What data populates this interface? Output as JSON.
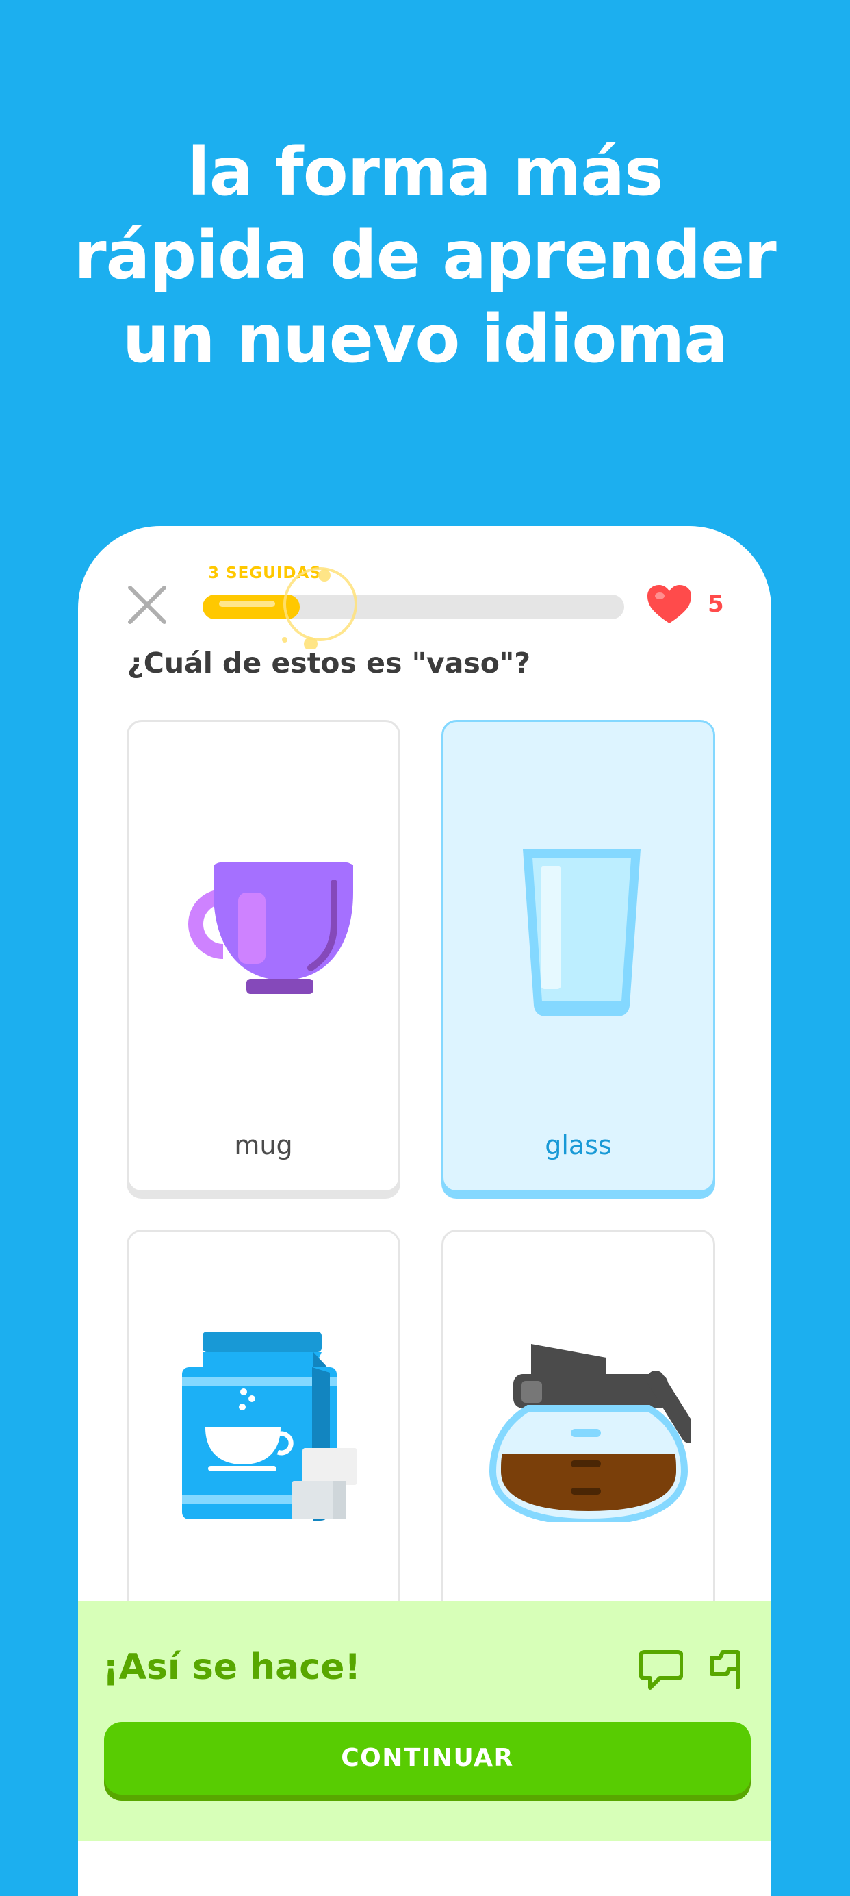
{
  "headline": {
    "line1": "la forma más",
    "line2": "rápida de aprender",
    "line3": "un nuevo idioma"
  },
  "lesson": {
    "streak_label": "3 SEGUIDAS",
    "progress": 0.23,
    "lives": "5",
    "question": "¿Cuál de estos es \"vaso\"?",
    "options": [
      {
        "label": "mug",
        "icon": "mug-icon",
        "selected": false
      },
      {
        "label": "glass",
        "icon": "glass-icon",
        "selected": true
      },
      {
        "label": "",
        "icon": "coffee-bag-icon",
        "selected": false
      },
      {
        "label": "",
        "icon": "coffee-pot-icon",
        "selected": false
      }
    ]
  },
  "feedback": {
    "title": "¡Así se hace!",
    "continue_label": "CONTINUAR"
  },
  "colors": {
    "background": "#1cafef",
    "progress": "#ffc800",
    "heart": "#ff4b4b",
    "selected_border": "#84d8ff",
    "correct_banner": "#d7ffb8",
    "continue_button": "#58cc02"
  }
}
